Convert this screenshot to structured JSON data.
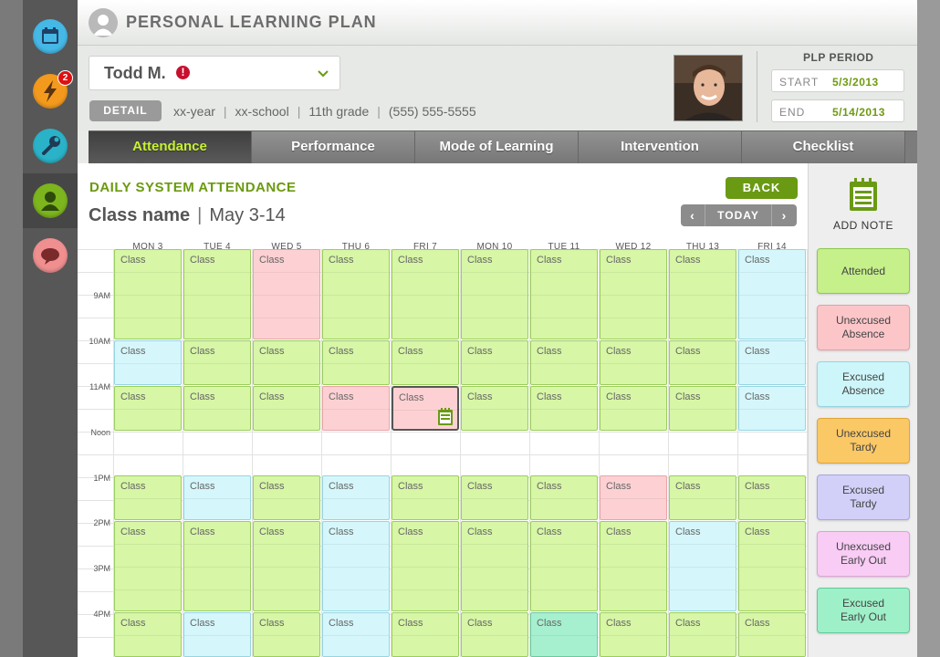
{
  "app": {
    "title": "PERSONAL LEARNING PLAN",
    "nav": [
      {
        "name": "calendar-icon",
        "color": "#45b8e6"
      },
      {
        "name": "lightning-icon",
        "color": "#f39a1e",
        "badge": "2"
      },
      {
        "name": "wrench-icon",
        "color": "#2ab3c8"
      },
      {
        "name": "person-icon",
        "color": "#7cb51e",
        "active": true
      },
      {
        "name": "chat-icon",
        "color": "#f08f8f"
      }
    ]
  },
  "student": {
    "name": "Todd M.",
    "detail_label": "DETAIL",
    "year": "xx-year",
    "school": "xx-school",
    "grade": "11th grade",
    "phone": "(555) 555-5555"
  },
  "plp": {
    "label": "PLP PERIOD",
    "start_label": "START",
    "start": "5/3/2013",
    "end_label": "END",
    "end": "5/14/2013"
  },
  "tabs": [
    {
      "label": "Attendance",
      "active": true
    },
    {
      "label": "Performance"
    },
    {
      "label": "Mode of Learning"
    },
    {
      "label": "Intervention"
    },
    {
      "label": "Checklist"
    }
  ],
  "attendance": {
    "section_title": "DAILY SYSTEM ATTENDANCE",
    "class_name": "Class name",
    "date_range": "May 3-14",
    "back_label": "BACK",
    "today_label": "TODAY",
    "prev_glyph": "‹",
    "next_glyph": "›",
    "days": [
      "MON 3",
      "TUE 4",
      "WED 5",
      "THU 6",
      "FRI 7",
      "MON 10",
      "TUE 11",
      "WED 12",
      "THU 13",
      "FRI 14"
    ],
    "time_labels": [
      "9AM",
      "10AM",
      "11AM",
      "Noon",
      "1PM",
      "2PM",
      "3PM",
      "4PM"
    ],
    "class_label": "Class",
    "periods": [
      [
        "att",
        "att",
        "ua",
        "att",
        "att",
        "att",
        "att",
        "att",
        "att",
        "ea"
      ],
      [
        "ea",
        "att",
        "att",
        "att",
        "att",
        "att",
        "att",
        "att",
        "att",
        "ea"
      ],
      [
        "att",
        "att",
        "att",
        "ua",
        "ua",
        "att",
        "att",
        "att",
        "att",
        "ea"
      ],
      [
        "att",
        "ea",
        "att",
        "ea",
        "att",
        "att",
        "att",
        "ua",
        "att",
        "att"
      ],
      [
        "att",
        "att",
        "att",
        "ea",
        "att",
        "att",
        "att",
        "att",
        "ea",
        "att"
      ],
      [
        "att",
        "ea",
        "att",
        "ea",
        "att",
        "att",
        "eo",
        "att",
        "att",
        "att"
      ]
    ]
  },
  "legend": {
    "add_note_label": "ADD NOTE",
    "items": [
      {
        "label1": "Attended",
        "label2": "",
        "bg": "#c5f08a",
        "border": "#8cc94d"
      },
      {
        "label1": "Unexcused",
        "label2": "Absence",
        "bg": "#fcc6c9",
        "border": "#e6a0a4"
      },
      {
        "label1": "Excused",
        "label2": "Absence",
        "bg": "#cdf6fa",
        "border": "#97d5e0"
      },
      {
        "label1": "Unexcused",
        "label2": "Tardy",
        "bg": "#fbc866",
        "border": "#e0a53c"
      },
      {
        "label1": "Excused",
        "label2": "Tardy",
        "bg": "#d2d0f8",
        "border": "#a8a5e0"
      },
      {
        "label1": "Unexcused",
        "label2": "Early Out",
        "bg": "#f8ccf5",
        "border": "#dea2d8"
      },
      {
        "label1": "Excused",
        "label2": "Early Out",
        "bg": "#9ef0c8",
        "border": "#62c99a"
      }
    ]
  }
}
